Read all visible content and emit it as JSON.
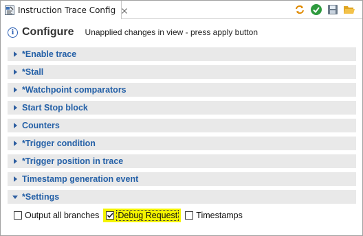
{
  "tab": {
    "title": "Instruction Trace Config"
  },
  "header": {
    "title": "Configure",
    "status": "Unapplied changes in view - press apply button"
  },
  "toolbar": {
    "icons": [
      "sync-icon",
      "apply-check-icon",
      "save-icon",
      "open-folder-icon"
    ]
  },
  "sections": [
    {
      "label": "*Enable trace",
      "expanded": false
    },
    {
      "label": "*Stall",
      "expanded": false
    },
    {
      "label": "*Watchpoint comparators",
      "expanded": false
    },
    {
      "label": "Start Stop block",
      "expanded": false
    },
    {
      "label": "Counters",
      "expanded": false
    },
    {
      "label": "*Trigger condition",
      "expanded": false
    },
    {
      "label": "*Trigger position in trace",
      "expanded": false
    },
    {
      "label": "Timestamp generation event",
      "expanded": false
    },
    {
      "label": "*Settings",
      "expanded": true
    }
  ],
  "settings": {
    "options": [
      {
        "label": "Output all branches",
        "checked": false
      },
      {
        "label": "Debug Request",
        "checked": true
      },
      {
        "label": "Timestamps",
        "checked": false
      }
    ]
  },
  "colors": {
    "section_label": "#2460a7",
    "section_bg": "#e9e9e9",
    "highlight": "#f4f400"
  }
}
